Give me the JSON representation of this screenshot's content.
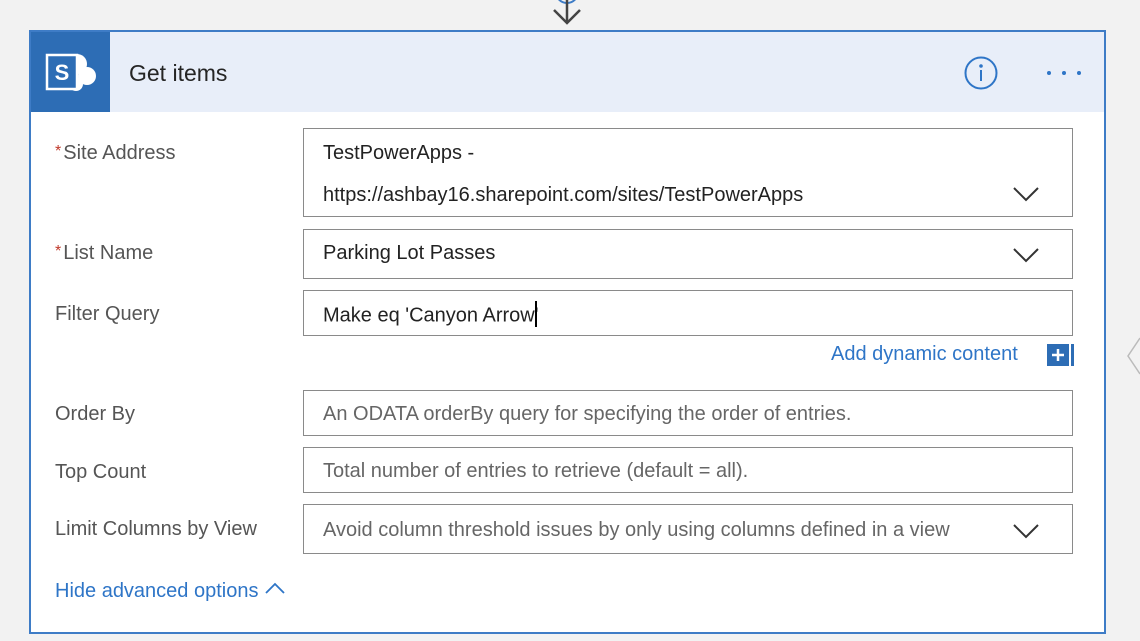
{
  "colors": {
    "accent": "#3e7cc6",
    "header_bg": "#e8eef9",
    "sharepoint_blue": "#2d6db5",
    "required": "#c0392b",
    "link": "#2e75c7"
  },
  "card": {
    "title": "Get items",
    "logo_letter": "S",
    "icons": {
      "logo": "sharepoint-logo",
      "info": "info-icon",
      "more": "more-options-icon",
      "connector_arrow": "arrow-down-icon",
      "side_chevron": "chevron-left-icon"
    }
  },
  "fields": {
    "site_address": {
      "required_marker": "*",
      "label": "Site Address",
      "value_line1": "TestPowerApps -",
      "value_line2": "https://ashbay16.sharepoint.com/sites/TestPowerApps"
    },
    "list_name": {
      "required_marker": "*",
      "label": "List Name",
      "value": "Parking Lot Passes"
    },
    "filter_query": {
      "label": "Filter Query",
      "value": "Make eq 'Canyon Arrow'"
    },
    "order_by": {
      "label": "Order By",
      "placeholder": "An ODATA orderBy query for specifying the order of entries."
    },
    "top_count": {
      "label": "Top Count",
      "placeholder": "Total number of entries to retrieve (default = all)."
    },
    "limit_columns": {
      "label": "Limit Columns by View",
      "placeholder": "Avoid column threshold issues by only using columns defined in a view"
    }
  },
  "add_dynamic_content": "Add dynamic content",
  "hide_advanced": "Hide advanced options"
}
